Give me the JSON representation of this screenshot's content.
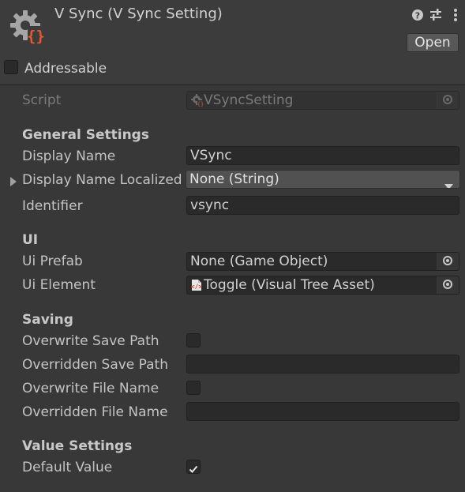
{
  "header": {
    "title": "V Sync (V Sync Setting)",
    "help_icon": "help-icon",
    "preset_icon": "presets-icon",
    "menu_icon": "kebab-menu-icon",
    "open_label": "Open",
    "addressable_label": "Addressable",
    "addressable_checked": false
  },
  "script": {
    "label": "Script",
    "value": "VSyncSetting"
  },
  "general": {
    "heading": "General Settings",
    "display_name_label": "Display Name",
    "display_name_value": "VSync",
    "display_name_localized_label": "Display Name Localized",
    "display_name_localized_value": "None (String)",
    "identifier_label": "Identifier",
    "identifier_value": "vsync"
  },
  "ui": {
    "heading": "UI",
    "ui_prefab_label": "Ui Prefab",
    "ui_prefab_value": "None (Game Object)",
    "ui_element_label": "Ui Element",
    "ui_element_value": "Toggle (Visual Tree Asset)"
  },
  "saving": {
    "heading": "Saving",
    "overwrite_save_path_label": "Overwrite Save Path",
    "overwrite_save_path_checked": false,
    "overridden_save_path_label": "Overridden Save Path",
    "overridden_save_path_value": "",
    "overwrite_file_name_label": "Overwrite File Name",
    "overwrite_file_name_checked": false,
    "overridden_file_name_label": "Overridden File Name",
    "overridden_file_name_value": ""
  },
  "value": {
    "heading": "Value Settings",
    "default_value_label": "Default Value",
    "default_value_checked": true
  },
  "colors": {
    "background": "#383838",
    "header": "#3c3c3c",
    "field": "#2a2a2a",
    "script_icon_accent": "#e8582c"
  }
}
